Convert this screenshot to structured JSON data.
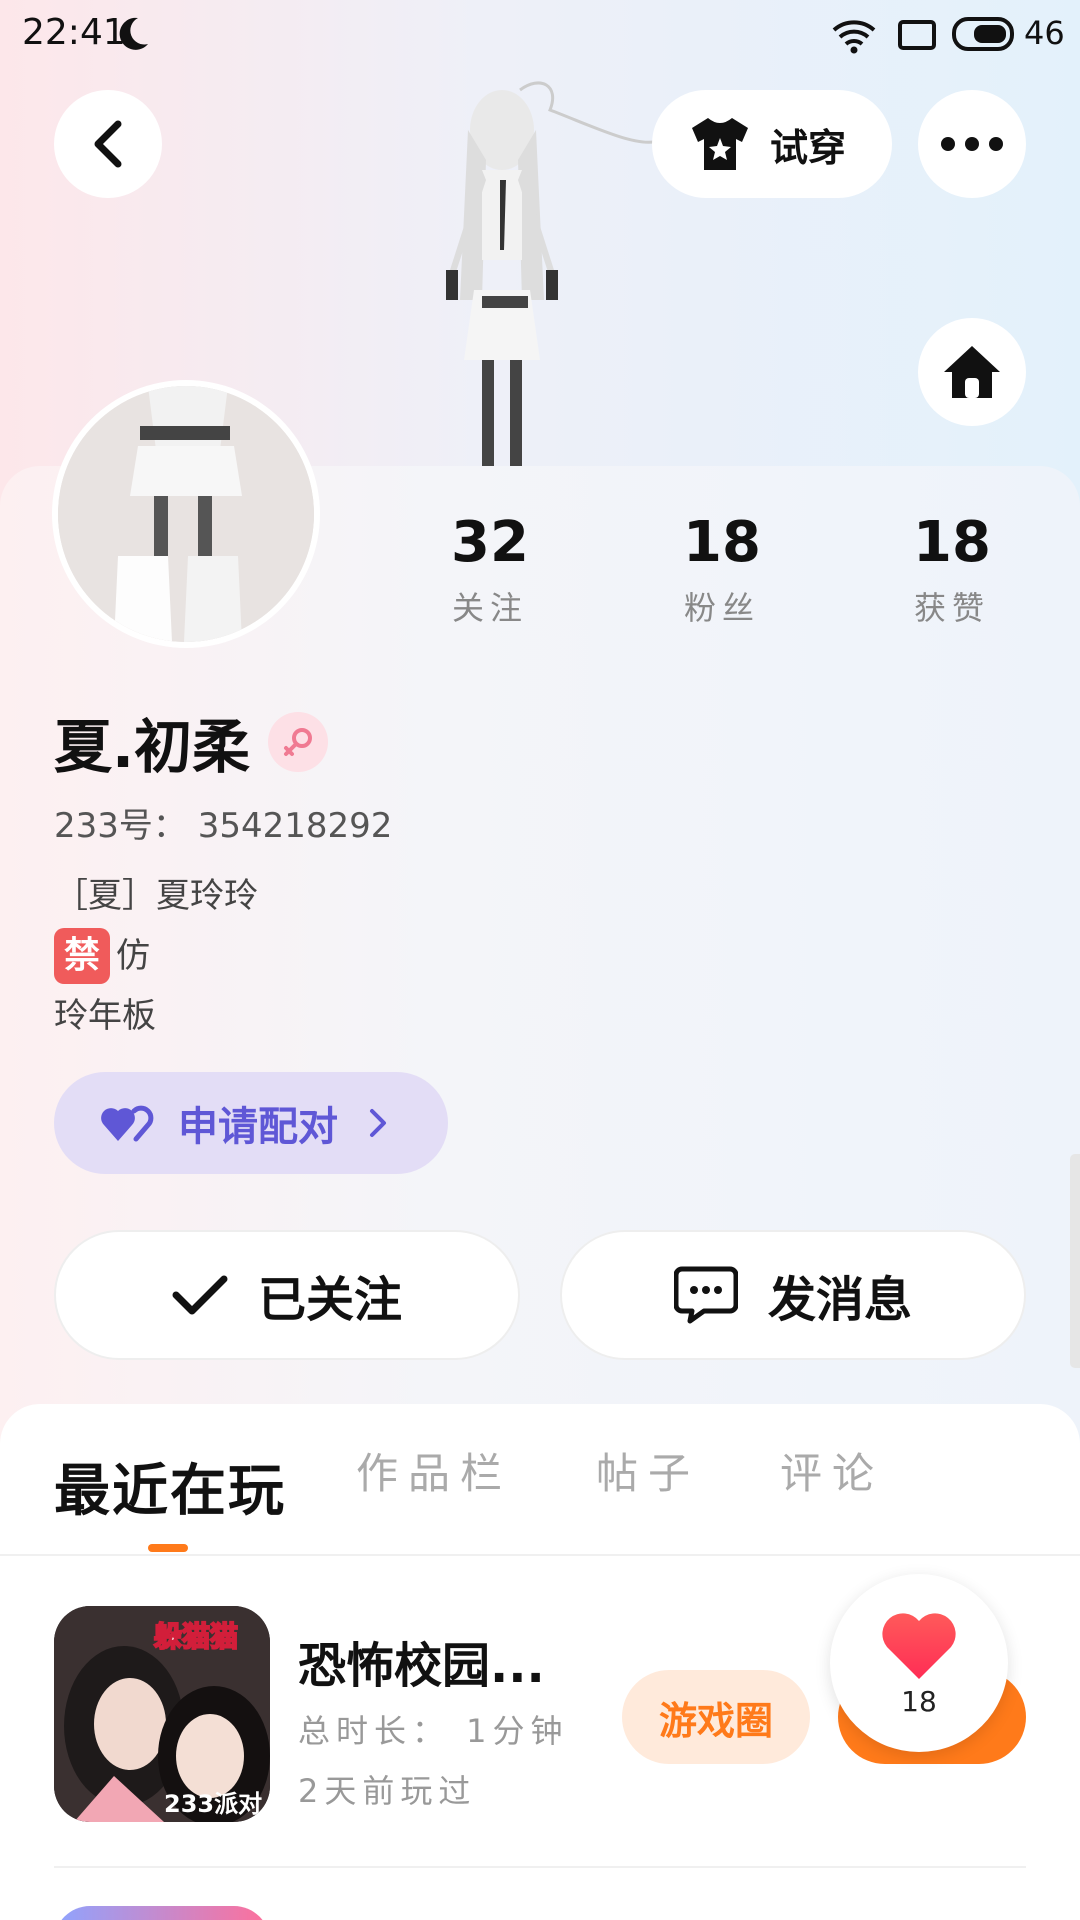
{
  "status_bar": {
    "time": "22:41",
    "battery": "46"
  },
  "header": {
    "try_on_label": "试穿"
  },
  "stats": [
    {
      "value": "32",
      "label": "关注"
    },
    {
      "value": "18",
      "label": "粉丝"
    },
    {
      "value": "18",
      "label": "获赞"
    }
  ],
  "profile": {
    "name": "夏.初柔",
    "uid": "233号： 354218292",
    "bio": [
      "［夏］夏玲玲",
      "仿",
      "玲年板"
    ],
    "bio_emoji": "禁"
  },
  "pair_button": {
    "label": "申请配对"
  },
  "actions": {
    "follow_label": "已关注",
    "message_label": "发消息"
  },
  "tabs": [
    "最近在玩",
    "作品栏",
    "帖子",
    "评论"
  ],
  "game": {
    "title": "恐怖校园...",
    "duration": "总时长： 1分钟",
    "last_played": "2天前玩过",
    "circle_label": "游戏圈",
    "icon_text": "躲猫猫",
    "icon_badge": "233派对"
  },
  "like_bubble": {
    "count": "18"
  },
  "colors": {
    "accent": "#ff7a1a",
    "pair": "#5f57d6",
    "pair_bg": "#e3ddf6"
  }
}
